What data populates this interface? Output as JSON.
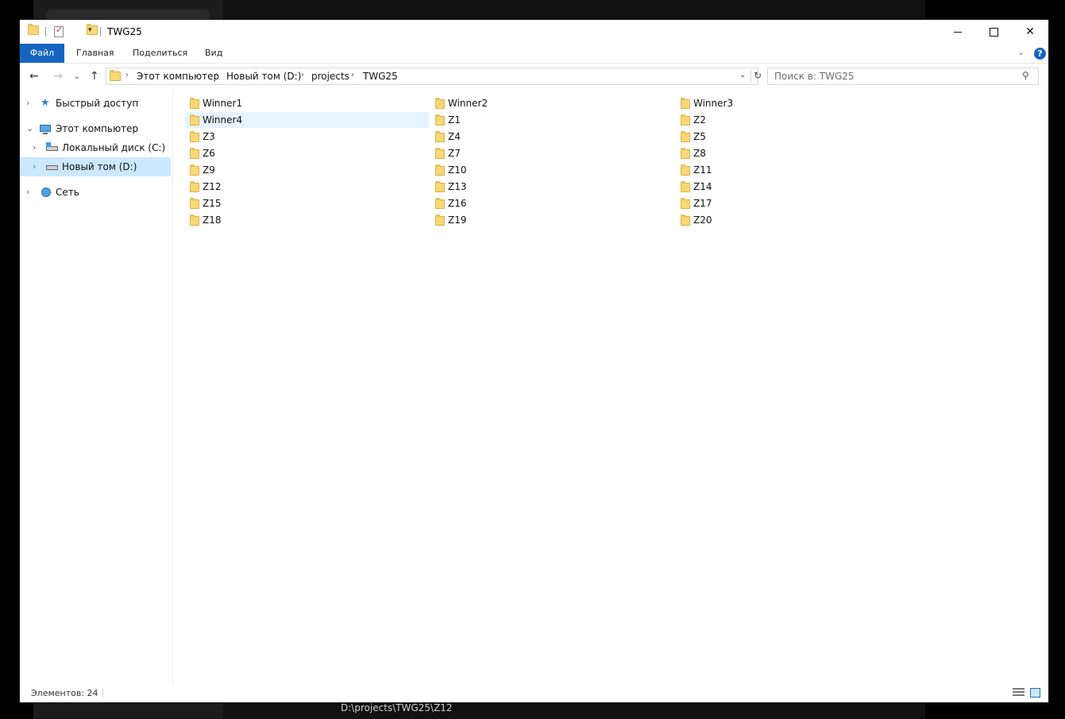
{
  "window": {
    "title": "TWG25",
    "controls": {
      "minimize": "minimize",
      "maximize": "maximize",
      "close": "✕"
    }
  },
  "ribbon": {
    "tabs": [
      "Файл",
      "Главная",
      "Поделиться",
      "Вид"
    ],
    "help": "?"
  },
  "address": {
    "crumbs": [
      "Этот компьютер",
      "Новый том (D:)",
      "projects",
      "TWG25"
    ]
  },
  "search": {
    "placeholder": "Поиск в: TWG25"
  },
  "navpane": {
    "items": [
      {
        "label": "Быстрый доступ",
        "icon": "star-icon",
        "expanded": false,
        "selected": false
      },
      {
        "label": "Этот компьютер",
        "icon": "computer-icon",
        "expanded": true,
        "selected": false
      },
      {
        "label": "Локальный диск (C:)",
        "icon": "drive-c-icon",
        "expanded": false,
        "selected": false
      },
      {
        "label": "Новый том (D:)",
        "icon": "drive-d-icon",
        "expanded": false,
        "selected": true
      },
      {
        "label": "Сеть",
        "icon": "network-icon",
        "expanded": false,
        "selected": false
      }
    ]
  },
  "folders": [
    "Winner1",
    "Winner2",
    "Winner3",
    "Winner4",
    "Z1",
    "Z2",
    "Z3",
    "Z4",
    "Z5",
    "Z6",
    "Z7",
    "Z8",
    "Z9",
    "Z10",
    "Z11",
    "Z12",
    "Z13",
    "Z14",
    "Z15",
    "Z16",
    "Z17",
    "Z18",
    "Z19",
    "Z20"
  ],
  "hovered_folder": "Winner4",
  "status": {
    "text": "Элементов: 24"
  },
  "background_app": {
    "path": "D:\\projects\\TWG25\\Z12"
  },
  "colors": {
    "accent": "#1565c0",
    "selection": "#cce8ff",
    "hover": "#e5f3ff",
    "folder": "#f8d775"
  }
}
